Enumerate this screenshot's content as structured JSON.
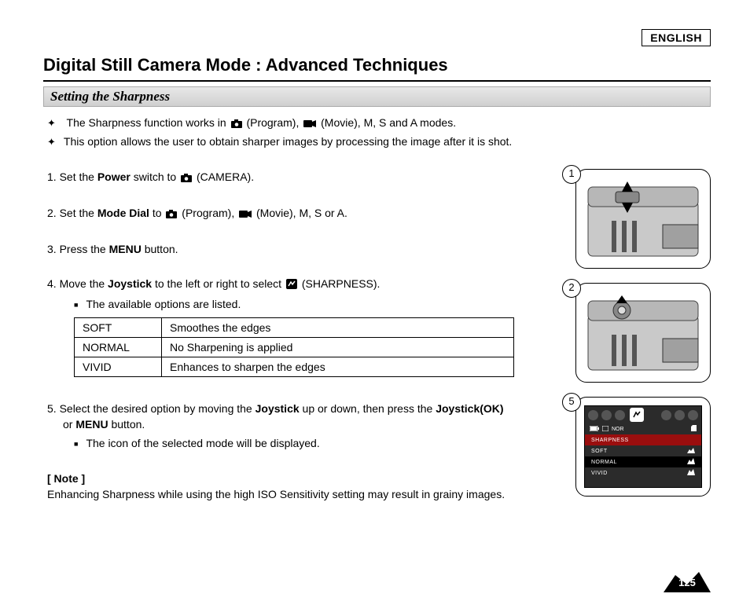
{
  "language_badge": "ENGLISH",
  "page_title": "Digital Still Camera Mode : Advanced Techniques",
  "section_title": "Setting the Sharpness",
  "intro": {
    "line1_a": "The Sharpness function works in ",
    "line1_b": " (Program),  ",
    "line1_c": " (Movie), M, S and A modes.",
    "line2": "This option allows the user to obtain sharper images by processing the image after it is shot."
  },
  "steps": {
    "s1_a": "1.  Set the ",
    "s1_b": "Power",
    "s1_c": " switch to ",
    "s1_d": " (CAMERA).",
    "s2_a": "2.  Set the ",
    "s2_b": "Mode Dial",
    "s2_c": " to  ",
    "s2_d": " (Program),  ",
    "s2_e": " (Movie), M, S or A.",
    "s3_a": "3.  Press the ",
    "s3_b": "MENU",
    "s3_c": " button.",
    "s4_a": "4.  Move the ",
    "s4_b": "Joystick",
    "s4_c": " to the left or right to select  ",
    "s4_d": " (SHARPNESS).",
    "s4_sub": "The available options are listed.",
    "options": [
      {
        "name": "SOFT",
        "desc": "Smoothes the edges"
      },
      {
        "name": "NORMAL",
        "desc": "No Sharpening is applied"
      },
      {
        "name": "VIVID",
        "desc": "Enhances to sharpen the edges"
      }
    ],
    "s5_a": "5.  Select the desired option by moving the ",
    "s5_b": "Joystick",
    "s5_c": " up or down, then press the ",
    "s5_d": "Joystick(OK)",
    "s5_e": "or ",
    "s5_f": "MENU",
    "s5_g": " button.",
    "s5_sub": "The icon of the selected mode will be displayed."
  },
  "note": {
    "head": "[ Note ]",
    "body": "Enhancing Sharpness while using the high ISO Sensitivity setting may result in grainy images."
  },
  "figures": {
    "fig1_num": "1",
    "fig2_num": "2",
    "menu_num": "5"
  },
  "menu": {
    "indicator": "NOR",
    "header": "SHARPNESS",
    "items": [
      "SOFT",
      "NORMAL",
      "VIVID"
    ],
    "selected_index": 1
  },
  "page_number": "125"
}
